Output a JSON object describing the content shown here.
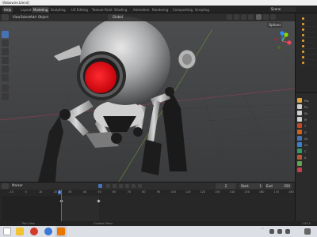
{
  "window": {
    "title": "\\Robowire.blend]"
  },
  "topbar": {
    "file_menu": "Help",
    "workspaces": [
      "Layout",
      "Modeling",
      "Sculpting",
      "UV Editing",
      "Texture Paint",
      "Shading",
      "Animation",
      "Rendering",
      "Compositing",
      "Scripting"
    ],
    "active_workspace_index": 1,
    "scene": "Scene"
  },
  "viewport": {
    "menus": [
      "View",
      "Select",
      "Add",
      "Object"
    ],
    "transform_label": "Global",
    "options_label": "Options",
    "nav_gizmo": {
      "x_color": "#e44860",
      "y_color": "#8bdc00",
      "z_color": "#2c8fff"
    }
  },
  "timeline": {
    "menus": [
      "Marker"
    ],
    "current_frame": "2",
    "start_label": "Start",
    "start_value": "1",
    "end_label": "End",
    "end_value": "250",
    "ruler_ticks": [
      "0",
      "10",
      "20",
      "30",
      "40",
      "50",
      "60",
      "70",
      "80",
      "90",
      "100",
      "110",
      "120",
      "130",
      "140",
      "150",
      "160",
      "170",
      "180",
      "190"
    ],
    "ticks_near": [
      "-10",
      "0",
      "10",
      "20",
      "30",
      "40",
      "50",
      "60",
      "70",
      "80",
      "90",
      "100",
      "110",
      "120",
      "130",
      "140",
      "150",
      "160",
      "170",
      "180"
    ]
  },
  "statusbar": {
    "left_text": "Pan View",
    "middle_text": "Context Menu",
    "version": "2.83.5"
  },
  "properties": {
    "lines": [
      "Pro",
      "P.s",
      "Sh",
      "M",
      "T",
      "D",
      "Vs",
      "Ct",
      "C",
      "A"
    ]
  },
  "colors": {
    "accent": "#4772b3",
    "eye": "#e8101a",
    "active_tab": "#3d3d3d",
    "grid": "#3c3d3f"
  }
}
